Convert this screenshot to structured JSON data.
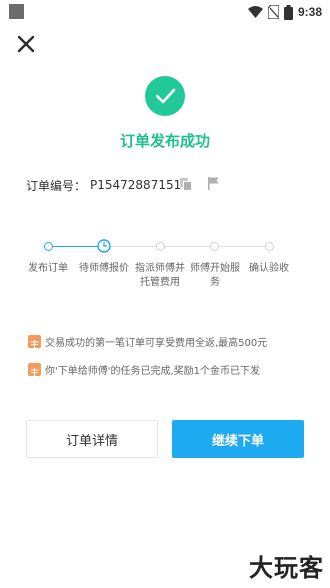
{
  "status_bar": {
    "time": "9:38"
  },
  "success": {
    "title": "订单发布成功"
  },
  "order": {
    "label": "订单编号：",
    "number": "P15472887151"
  },
  "steps": [
    {
      "label": "发布订单"
    },
    {
      "label": "待师傅报价"
    },
    {
      "label": "指派师傅并托管费用"
    },
    {
      "label": "师傅开始服务"
    },
    {
      "label": "确认验收"
    }
  ],
  "progress": {
    "current_step": 2,
    "total_steps": 5
  },
  "notices": [
    {
      "text": "交易成功的第一笔订单可享受费用全返,最高500元"
    },
    {
      "text": "你'下单给师傅'的任务已完成,奖励1个金币已下发"
    }
  ],
  "buttons": {
    "detail": "订单详情",
    "continue": "继续下单"
  },
  "watermark": "大玩客",
  "colors": {
    "success": "#20c997",
    "accent": "#1eaaf1",
    "notice_icon": "#f39a5d"
  }
}
